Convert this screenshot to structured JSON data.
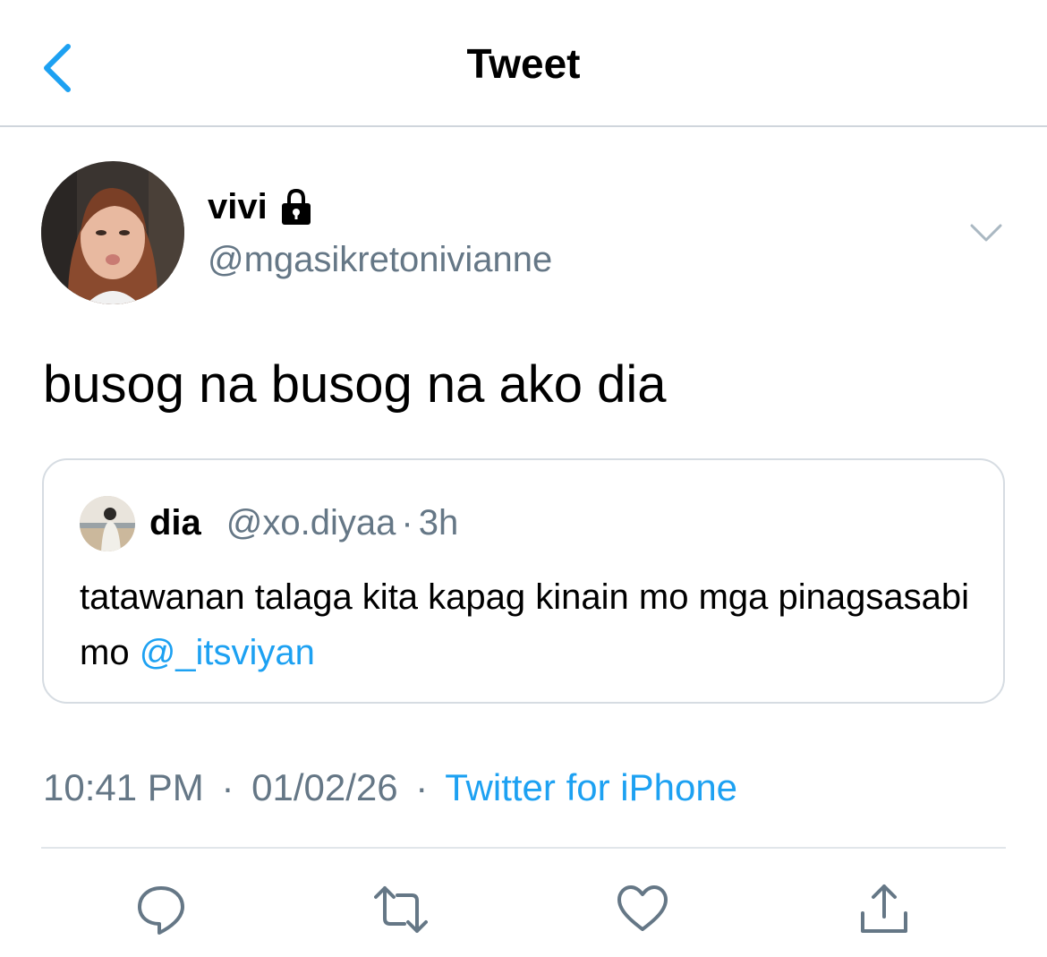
{
  "header": {
    "title": "Tweet"
  },
  "tweet": {
    "author": {
      "display_name": "vivi",
      "handle": "@mgasikretonivianne",
      "protected_icon": "lock-icon"
    },
    "text": "busog na busog na ako dia",
    "quoted": {
      "display_name": "dia",
      "handle": "@xo.diyaa",
      "separator": "·",
      "age": "3h",
      "text": "tatawanan talaga kita kapag kinain mo mga pinagsasabi mo ",
      "mention": "@_itsviyan"
    },
    "time": "10:41 PM",
    "date": "01/02/26",
    "separator": "·",
    "source": "Twitter for iPhone"
  },
  "actions": {
    "reply_icon": "reply-icon",
    "retweet_icon": "retweet-icon",
    "like_icon": "heart-icon",
    "share_icon": "share-icon"
  },
  "colors": {
    "accent": "#1da1f2",
    "secondary_text": "#657786",
    "border": "#d6dce2"
  }
}
